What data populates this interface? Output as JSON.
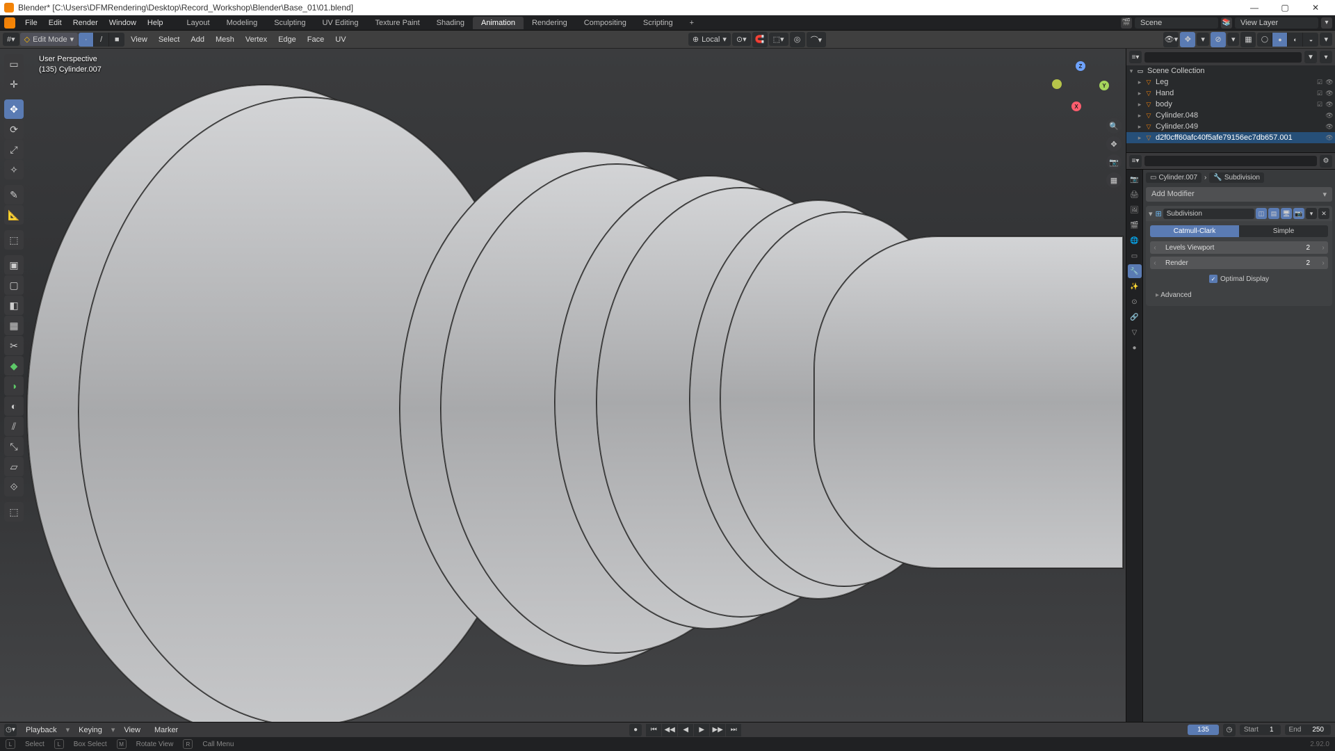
{
  "title": "Blender* [C:\\Users\\DFMRendering\\Desktop\\Record_Workshop\\Blender\\Base_01\\01.blend]",
  "window": {
    "minimize": "—",
    "maximize": "▢",
    "close": "✕"
  },
  "menubar": {
    "file": "File",
    "edit": "Edit",
    "render": "Render",
    "window": "Window",
    "help": "Help",
    "tabs": {
      "layout": "Layout",
      "modeling": "Modeling",
      "sculpting": "Sculpting",
      "uv": "UV Editing",
      "texture": "Texture Paint",
      "shading": "Shading",
      "animation": "Animation",
      "rendering": "Rendering",
      "compositing": "Compositing",
      "scripting": "Scripting",
      "add": "+"
    },
    "scene_label": "Scene",
    "view_layer": "View Layer"
  },
  "header": {
    "mode_label": "Edit Mode",
    "menus": {
      "view": "View",
      "select": "Select",
      "add": "Add",
      "mesh": "Mesh",
      "vertex": "Vertex",
      "edge": "Edge",
      "face": "Face",
      "uv": "UV"
    },
    "orientation": "Local"
  },
  "viewport": {
    "line1": "User Perspective",
    "line2": "(135) Cylinder.007"
  },
  "outliner": {
    "search_placeholder": "",
    "root": "Scene Collection",
    "items": [
      {
        "name": "Leg",
        "type": "collection"
      },
      {
        "name": "Hand",
        "type": "collection"
      },
      {
        "name": "body",
        "type": "collection"
      },
      {
        "name": "Cylinder.048",
        "type": "mesh"
      },
      {
        "name": "Cylinder.049",
        "type": "mesh"
      },
      {
        "name": "d2f0cff60afc40f5afe79156ec7db657.001",
        "type": "mesh"
      }
    ]
  },
  "breadcrumb": {
    "obj": "Cylinder.007",
    "mod": "Subdivision"
  },
  "addmod": "Add Modifier",
  "modifier": {
    "name": "Subdivision",
    "type_catmull": "Catmull-Clark",
    "type_simple": "Simple",
    "rows": {
      "viewport_label": "Levels Viewport",
      "viewport_val": "2",
      "render_label": "Render",
      "render_val": "2"
    },
    "optimal": "Optimal Display",
    "advanced": "Advanced"
  },
  "timeline": {
    "playback": "Playback",
    "keying": "Keying",
    "view": "View",
    "marker": "Marker",
    "current": "135",
    "start_label": "Start",
    "start_val": "1",
    "end_label": "End",
    "end_val": "250"
  },
  "status": {
    "select": "Select",
    "box": "Box Select",
    "rotate": "Rotate View",
    "call": "Call Menu",
    "version": "2.92.0"
  }
}
